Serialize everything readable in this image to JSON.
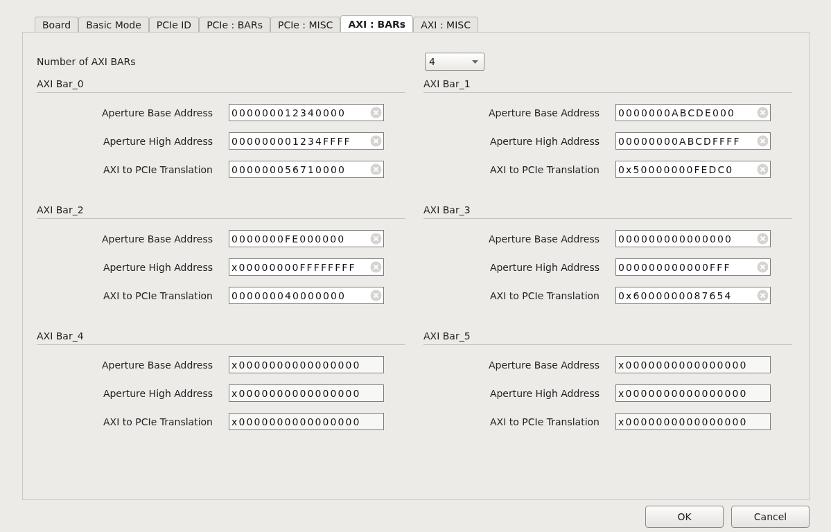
{
  "tabs": [
    {
      "label": "Board",
      "selected": false
    },
    {
      "label": "Basic Mode",
      "selected": false
    },
    {
      "label": "PCIe ID",
      "selected": false
    },
    {
      "label": "PCIe : BARs",
      "selected": false
    },
    {
      "label": "PCIe : MISC",
      "selected": false
    },
    {
      "label": "AXI : BARs",
      "selected": true
    },
    {
      "label": "AXI : MISC",
      "selected": false
    }
  ],
  "bar_count": {
    "label": "Number of AXI BARs",
    "value": "4"
  },
  "bars": [
    {
      "title": "AXI Bar_0",
      "enabled": true,
      "fields": [
        {
          "label": "Aperture Base Address",
          "value": "000000012340000"
        },
        {
          "label": "Aperture High Address",
          "value": "000000001234FFFF"
        },
        {
          "label": "AXI to PCIe Translation",
          "value": "000000056710000"
        }
      ]
    },
    {
      "title": "AXI Bar_1",
      "enabled": true,
      "fields": [
        {
          "label": "Aperture Base Address",
          "value": "0000000ABCDE000"
        },
        {
          "label": "Aperture High Address",
          "value": "00000000ABCDFFFF"
        },
        {
          "label": "AXI to PCIe Translation",
          "value": "0x50000000FEDC0"
        }
      ]
    },
    {
      "title": "AXI Bar_2",
      "enabled": true,
      "fields": [
        {
          "label": "Aperture Base Address",
          "value": "0000000FE000000"
        },
        {
          "label": "Aperture High Address",
          "value": "x00000000FFFFFFFF"
        },
        {
          "label": "AXI to PCIe Translation",
          "value": "000000040000000"
        }
      ]
    },
    {
      "title": "AXI Bar_3",
      "enabled": true,
      "fields": [
        {
          "label": "Aperture Base Address",
          "value": "000000000000000"
        },
        {
          "label": "Aperture High Address",
          "value": "000000000000FFF"
        },
        {
          "label": "AXI to PCIe Translation",
          "value": "0x6000000087654"
        }
      ]
    },
    {
      "title": "AXI Bar_4",
      "enabled": false,
      "fields": [
        {
          "label": "Aperture Base Address",
          "value": "x0000000000000000"
        },
        {
          "label": "Aperture High Address",
          "value": "x0000000000000000"
        },
        {
          "label": "AXI to PCIe Translation",
          "value": "x0000000000000000"
        }
      ]
    },
    {
      "title": "AXI Bar_5",
      "enabled": false,
      "fields": [
        {
          "label": "Aperture Base Address",
          "value": "x0000000000000000"
        },
        {
          "label": "Aperture High Address",
          "value": "x0000000000000000"
        },
        {
          "label": "AXI to PCIe Translation",
          "value": "x0000000000000000"
        }
      ]
    }
  ],
  "buttons": [
    "OK",
    "Cancel"
  ]
}
